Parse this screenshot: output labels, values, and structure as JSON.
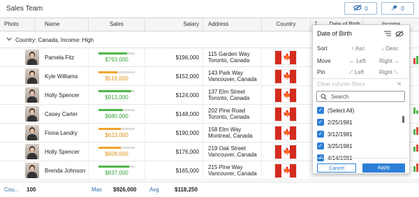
{
  "app": {
    "title": "Sales Team"
  },
  "toolbar": {
    "hide_count": "0",
    "pin_count": "0"
  },
  "columns": {
    "photo": "Photo",
    "name": "Name",
    "sales": "Sales",
    "salary": "Salary",
    "address": "Address",
    "country": "Country",
    "date_of_birth": "Date of Birth",
    "income": "Income"
  },
  "group": {
    "label": "Country: Canada, Income: High"
  },
  "rows": [
    {
      "name": "Pamela Fitz",
      "sales": "$793,000",
      "sales_fraction": 0.79,
      "bar_color": "#4fb648",
      "value_color": "#3aa43a",
      "salary": "$196,000",
      "addr1": "115 Garden Way",
      "addr2": "Toronto, Canada"
    },
    {
      "name": "Kyle Williams",
      "sales": "$519,000",
      "sales_fraction": 0.52,
      "bar_color": "#f0a32d",
      "value_color": "#e0911b",
      "salary": "$152,000",
      "addr1": "143 Park Way",
      "addr2": "Vancouver, Canada"
    },
    {
      "name": "Holly Spencer",
      "sales": "$913,000",
      "sales_fraction": 0.91,
      "bar_color": "#4fb648",
      "value_color": "#3aa43a",
      "salary": "$124,000",
      "addr1": "137 Elm Street",
      "addr2": "Toronto, Canada"
    },
    {
      "name": "Casey Carter",
      "sales": "$680,000",
      "sales_fraction": 0.68,
      "bar_color": "#4fb648",
      "value_color": "#3aa43a",
      "salary": "$148,000",
      "addr1": "202 Pine Road",
      "addr2": "Toronto, Canada"
    },
    {
      "name": "Fiona Landry",
      "sales": "$623,000",
      "sales_fraction": 0.62,
      "bar_color": "#f0a32d",
      "value_color": "#e0911b",
      "salary": "$190,000",
      "addr1": "158 Elm Way",
      "addr2": "Montreal, Canada"
    },
    {
      "name": "Holly Spencer",
      "sales": "$608,000",
      "sales_fraction": 0.61,
      "bar_color": "#f0a32d",
      "value_color": "#e0911b",
      "salary": "$176,000",
      "addr1": "219 Oak Street",
      "addr2": "Vancouver, Canada"
    },
    {
      "name": "Brenda Johnson",
      "sales": "$837,000",
      "sales_fraction": 0.84,
      "bar_color": "#4fb648",
      "value_color": "#3aa43a",
      "salary": "$165,000",
      "addr1": "215 Pine Way",
      "addr2": "Vancouver, Canada"
    }
  ],
  "footer": {
    "count_label": "Cou...",
    "count_value": "100",
    "max_label": "Max",
    "max_value": "$926,000",
    "avg_label": "Avg",
    "avg_value": "$118,250"
  },
  "popup": {
    "title": "Date of Birth",
    "sort_label": "Sort",
    "sort_asc": "Asc",
    "sort_desc": "Desc",
    "move_label": "Move",
    "move_left": "Left",
    "move_right": "Right",
    "pin_label": "Pin",
    "pin_left": "Left",
    "pin_right": "Right",
    "clear_filters": "Clear column filters",
    "search_placeholder": "Search",
    "options": [
      "(Select All)",
      "2/25/1981",
      "3/12/1981",
      "3/25/1981",
      "4/14/1981"
    ],
    "cancel": "Cancel",
    "apply": "Apply"
  },
  "colors": {
    "accent": "#2d7fd6",
    "green": "#4fb648",
    "orange": "#f0a32d",
    "flag_red": "#d52b1e"
  }
}
